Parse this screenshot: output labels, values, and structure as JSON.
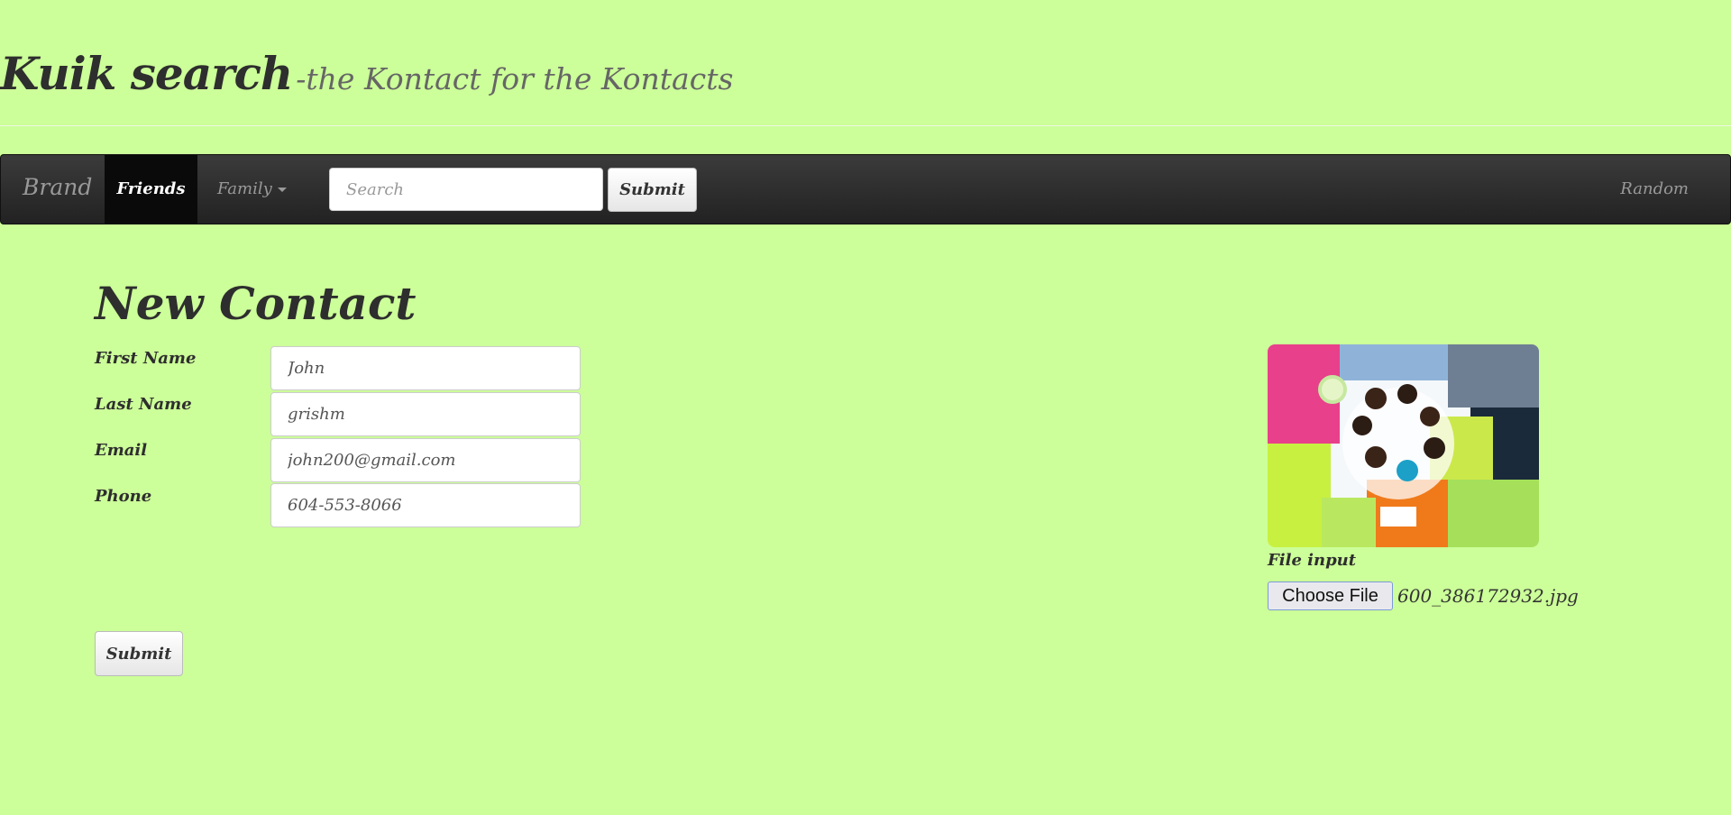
{
  "header": {
    "title": "Kuik search",
    "subtitle": "-the Kontact for the Kontacts"
  },
  "navbar": {
    "brand": "Brand",
    "items": [
      {
        "label": "Friends",
        "active": true
      },
      {
        "label": "Family",
        "dropdown": true
      }
    ],
    "search_placeholder": "Search",
    "search_button": "Submit",
    "right_link": "Random"
  },
  "form": {
    "title": "New Contact",
    "fields": [
      {
        "label": "First Name",
        "value": "John"
      },
      {
        "label": "Last Name",
        "value": "grishm"
      },
      {
        "label": "Email",
        "value": "john200@gmail.com"
      },
      {
        "label": "Phone",
        "value": "604-553-8066"
      }
    ],
    "submit_label": "Submit"
  },
  "upload": {
    "file_label": "File input",
    "choose_button": "Choose File",
    "file_name": "600_386172932.jpg"
  },
  "colors": {
    "page_background": "#ccff99",
    "navbar_background": "#2b2b2b",
    "active_nav": "#0a0a0a"
  }
}
